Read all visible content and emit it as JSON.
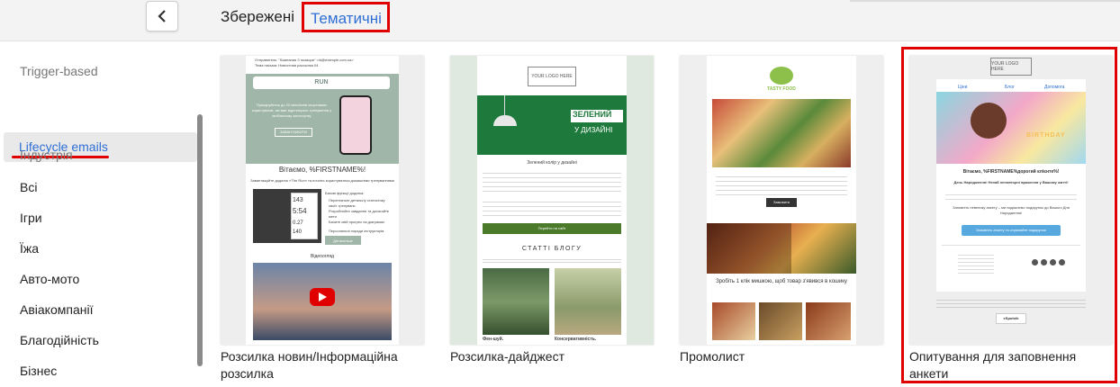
{
  "header": {
    "tabs": [
      {
        "label": "Збережені"
      },
      {
        "label": "Тематичні"
      }
    ]
  },
  "sidebar": {
    "items": [
      {
        "label": "Trigger-based"
      },
      {
        "label": "Lifecycle emails"
      },
      {
        "label": "Індустрія"
      },
      {
        "label": "Всі"
      },
      {
        "label": "Ігри"
      },
      {
        "label": "Їжа"
      },
      {
        "label": "Авто-мото"
      },
      {
        "label": "Авіакомпанії"
      },
      {
        "label": "Благодійність"
      },
      {
        "label": "Бізнес"
      }
    ]
  },
  "templates": [
    {
      "title": "Розсилка новин/Інформаційна розсилка",
      "preview": {
        "from_line": "Отправитель: \"Компания З позиции\" <id@example.com.ua>",
        "subject_line": "Тема письма: Новостная рассылка 04",
        "banner_word": "RUN",
        "banner_text": "Приєднуйтесь до 20 мільйонів спортивних користувачів, які вже відстежують тренування у мобільному застосунку",
        "banner_button": "ЗАВАНТАЖИТИ",
        "greeting": "Вітаємо, %FIRSTNAME%!",
        "intro": "Завантажуйте додаток «The Run» та почніть користуватися домашніми тренуваннями",
        "features_title": "Базові функції додатка:",
        "features": [
          "Перегляньте детальну статистику своїх тренувань",
          "Розробляйте завдання та досягайте мети",
          "Бачите свій прогрес на діаграмах",
          "Персональні поради інструкторів"
        ],
        "features_button": "Детальніше",
        "video_title": "Відеоогляд",
        "watch_numbers": [
          "143",
          "5:54",
          "0.27",
          "140"
        ]
      }
    },
    {
      "title": "Розсилка-дайджест",
      "preview": {
        "logo": "YOUR LOGO HERE",
        "hero_title_1": "ЗЕЛЕНИЙ",
        "hero_title_2": "У ДИЗАЙНІ",
        "subtitle": "Зелений колір у дизайні",
        "button": "Перейти на сайт",
        "section": "СТАТТІ БЛОГУ",
        "caption_1": "Фен-шуй.",
        "caption_2": "Консервативність."
      }
    },
    {
      "title": "Промолист",
      "preview": {
        "brand": "TASTY FOOD",
        "button": "Замовити",
        "headline": "Зробіть 1 клік мишкою, щоб товар з'явився в кошику"
      }
    },
    {
      "title": "Опитування для заповнення анкети",
      "preview": {
        "logo": "YOUR LOGO HERE",
        "nav": [
          "Ціни",
          "Блог",
          "Допомога"
        ],
        "cake_text": "BIRTHDAY",
        "greeting": "Вітаємо, %FIRSTNAME%дорогий клієнте%!",
        "lead": "День Народження! Нехай неповторні враження у Вашому житті!",
        "body": "Заповніть невелику анкету – ми надішлемо подарунок до Вашого Дня Народження!",
        "button": "Заповніть анкету та отримайте подарунок",
        "badge": "eSputnik"
      }
    }
  ],
  "colors": {
    "accent_blue": "#2f6fd6",
    "highlight_red": "#e00000",
    "digest_green": "#1e7a3c",
    "button_blue": "#58a8e0"
  }
}
